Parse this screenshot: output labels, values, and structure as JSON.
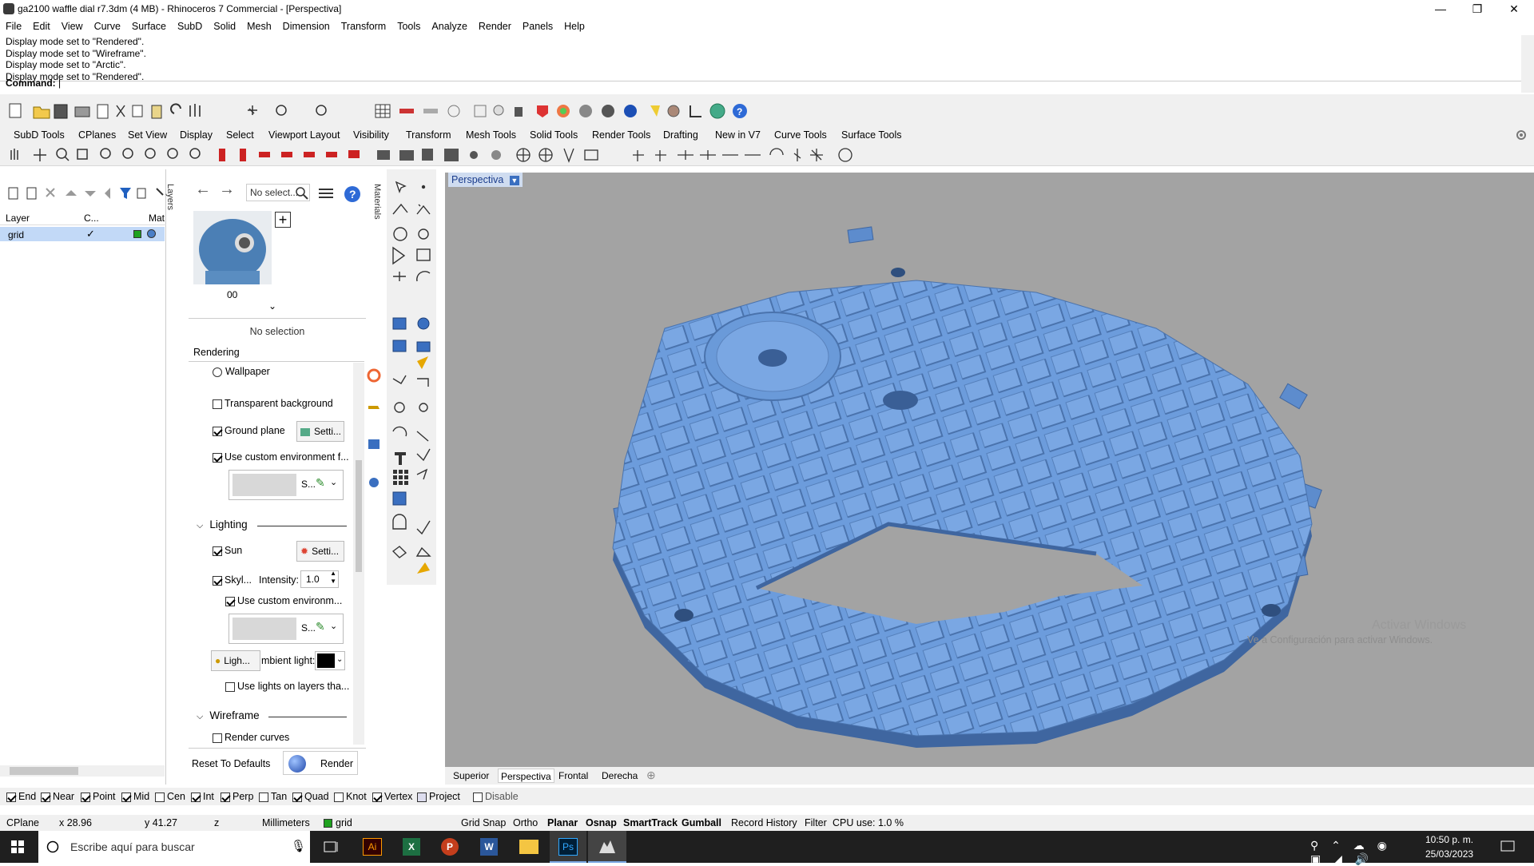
{
  "window": {
    "title": "ga2100 waffle dial r7.3dm (4 MB) - Rhinoceros 7 Commercial - [Perspectiva]",
    "minimize": "—",
    "restore": "❐",
    "close": "✕"
  },
  "menu": [
    "File",
    "Edit",
    "View",
    "Curve",
    "Surface",
    "SubD",
    "Solid",
    "Mesh",
    "Dimension",
    "Transform",
    "Tools",
    "Analyze",
    "Render",
    "Panels",
    "Help"
  ],
  "command_history": [
    "Display mode set to \"Rendered\".",
    "Display mode set to \"Wireframe\".",
    "Display mode set to \"Arctic\".",
    "Display mode set to \"Rendered\"."
  ],
  "command_prompt": "Command:",
  "toolbar_tabs": [
    "SubD Tools",
    "CPlanes",
    "Set View",
    "Display",
    "Select",
    "Viewport Layout",
    "Visibility",
    "Transform",
    "Mesh Tools",
    "Solid Tools",
    "Render Tools",
    "Drafting",
    "New in V7",
    "Curve Tools",
    "Surface Tools"
  ],
  "layers": {
    "panel_tab": "Layers",
    "col_layer": "Layer",
    "col_current": "C...",
    "col_material": "Mat",
    "rows": [
      {
        "name": "grid",
        "color": "#1fa21f"
      }
    ]
  },
  "properties": {
    "search_placeholder": "No select...",
    "materials_tab": "Materials",
    "thumb_label": "00",
    "no_selection": "No selection",
    "rendering_header": "Rendering",
    "wallpaper": "Wallpaper",
    "transparent_bg": "Transparent background",
    "ground_plane": "Ground plane",
    "settings_short": "Setti...",
    "use_custom_env": "Use custom environment f...",
    "env_short": "S...",
    "lighting_section": "Lighting",
    "sun": "Sun",
    "skylight": "Skyl...",
    "intensity_label": "Intensity:",
    "intensity_value": "1.0",
    "use_custom_env2": "Use custom environm...",
    "light_btn": "Ligh...",
    "ambient_label": "mbient light:",
    "use_lights_layers": "Use lights on layers tha...",
    "wireframe_section": "Wireframe",
    "render_curves": "Render curves",
    "reset_defaults": "Reset To Defaults",
    "render_button": "Render"
  },
  "viewport": {
    "name": "Perspectiva",
    "watermark_title": "Activar Windows",
    "watermark_sub": "Ve a Configuración para activar Windows.",
    "background": "#a3a3a3",
    "object_color": "#6a9ad9"
  },
  "view_tabs": [
    "Superior",
    "Perspectiva",
    "Frontal",
    "Derecha"
  ],
  "osnaps": [
    {
      "label": "End",
      "checked": true
    },
    {
      "label": "Near",
      "checked": true
    },
    {
      "label": "Point",
      "checked": true
    },
    {
      "label": "Mid",
      "checked": true
    },
    {
      "label": "Cen",
      "checked": false
    },
    {
      "label": "Int",
      "checked": true
    },
    {
      "label": "Perp",
      "checked": true
    },
    {
      "label": "Tan",
      "checked": false
    },
    {
      "label": "Quad",
      "checked": true
    },
    {
      "label": "Knot",
      "checked": false
    },
    {
      "label": "Vertex",
      "checked": true
    },
    {
      "label": "Project",
      "checked": false
    },
    {
      "label": "Disable",
      "checked": false
    }
  ],
  "status": {
    "cplane": "CPlane",
    "x": "x 28.96",
    "y": "y 41.27",
    "z": "z",
    "units": "Millimeters",
    "layer": "grid",
    "grid_snap": "Grid Snap",
    "ortho": "Ortho",
    "planar": "Planar",
    "osnap": "Osnap",
    "smarttrack": "SmartTrack",
    "gumball": "Gumball",
    "record_history": "Record History",
    "filter": "Filter",
    "cpu": "CPU use: 1.0 %"
  },
  "taskbar": {
    "search_placeholder": "Escribe aquí para buscar",
    "time": "10:50 p. m.",
    "date": "25/03/2023"
  }
}
